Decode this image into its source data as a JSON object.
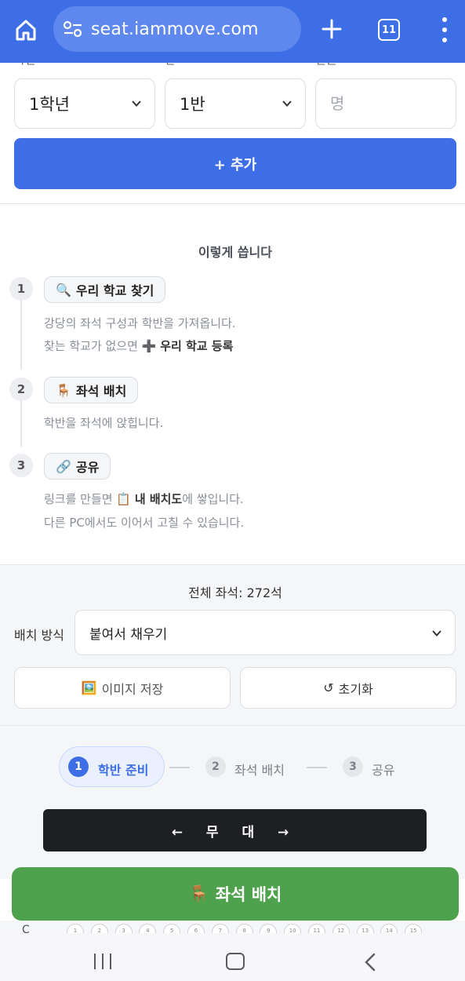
{
  "browser": {
    "url": "seat.iammove.com",
    "tab_count": "11"
  },
  "form": {
    "grade_label": "학년",
    "class_label": "반",
    "count_label": "인원",
    "grade_value": "1학년",
    "class_value": "1반",
    "count_placeholder": "명",
    "add_button": "+ 추가"
  },
  "howto": {
    "title": "이렇게 씁니다",
    "steps": [
      {
        "number": "1",
        "chip_icon": "🔍",
        "chip_label": "우리 학교 찾기",
        "desc_line1": "강당의 좌석 구성과 학반을 가져옵니다.",
        "desc_line2_prefix": "찾는 학교가 없으면 ",
        "desc_line2_icon": "➕",
        "desc_line2_bold": "우리 학교 등록"
      },
      {
        "number": "2",
        "chip_icon": "🪑",
        "chip_label": "좌석 배치",
        "desc_line1": "학반을 좌석에 앉힙니다."
      },
      {
        "number": "3",
        "chip_icon": "🔗",
        "chip_label": "공유",
        "desc_line1_prefix": "링크를 만들면 ",
        "desc_line1_icon": "📋",
        "desc_line1_bold": "내 배치도",
        "desc_line1_suffix": "에 쌓입니다.",
        "desc_line2": "다른 PC에서도 이어서 고칠 수 있습니다."
      }
    ]
  },
  "controls": {
    "total_seats": "전체 좌석: 272석",
    "mode_label": "배치 방식",
    "mode_value": "붙여서 채우기",
    "save_image_icon": "🖼️",
    "save_image": "이미지 저장",
    "reset_icon": "↺",
    "reset": "초기화"
  },
  "progress": {
    "steps": [
      {
        "number": "1",
        "label": "학반 준비",
        "active": true
      },
      {
        "number": "2",
        "label": "좌석 배치",
        "active": false
      },
      {
        "number": "3",
        "label": "공유",
        "active": false
      }
    ]
  },
  "stage": {
    "label": "← 무 대 →"
  },
  "fab": {
    "icon": "🪑",
    "label": "좌석 배치"
  },
  "seat_preview": {
    "row": "C",
    "seats": [
      "1",
      "2",
      "3",
      "4",
      "5",
      "6",
      "7",
      "8",
      "9",
      "10",
      "11",
      "12",
      "13",
      "14",
      "15"
    ]
  },
  "colors": {
    "primary": "#3d6ee6",
    "fab_green": "#4ea24e",
    "stage_dark": "#1d1f22"
  }
}
